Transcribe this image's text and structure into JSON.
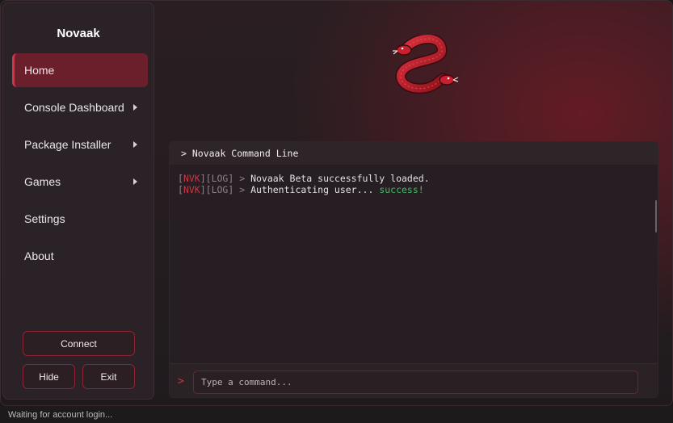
{
  "app": {
    "title": "Novaak"
  },
  "sidebar": {
    "items": [
      {
        "label": "Home",
        "active": true,
        "has_submenu": false
      },
      {
        "label": "Console Dashboard",
        "active": false,
        "has_submenu": true
      },
      {
        "label": "Package Installer",
        "active": false,
        "has_submenu": true
      },
      {
        "label": "Games",
        "active": false,
        "has_submenu": true
      },
      {
        "label": "Settings",
        "active": false,
        "has_submenu": false
      },
      {
        "label": "About",
        "active": false,
        "has_submenu": false
      }
    ],
    "connect_label": "Connect",
    "hide_label": "Hide",
    "exit_label": "Exit"
  },
  "logo": {
    "icon": "two-headed-serpent-icon",
    "color": "#c8202e"
  },
  "console": {
    "header": "> Novaak Command Line",
    "lines": [
      {
        "tag": "NVK",
        "level": "LOG",
        "message": "Novaak Beta successfully loaded.",
        "status": ""
      },
      {
        "tag": "NVK",
        "level": "LOG",
        "message": "Authenticating user... ",
        "status": "success!"
      }
    ],
    "prompt_symbol": ">",
    "input_value": "",
    "input_placeholder": "Type a command..."
  },
  "statusbar": {
    "text": "Waiting for account login..."
  },
  "colors": {
    "accent": "#d63347",
    "success": "#3fbf60",
    "tag": "#c23a48"
  }
}
